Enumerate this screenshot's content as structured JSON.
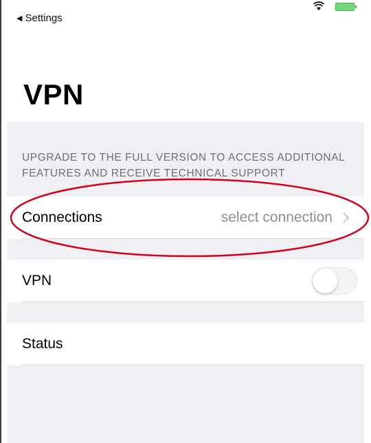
{
  "status_bar": {
    "back_label": "Settings",
    "icons": [
      "wifi-icon",
      "battery-icon"
    ],
    "battery_color": "#39b54a"
  },
  "header": {
    "title": "VPN"
  },
  "upgrade_note": "UPGRADE TO THE FULL VERSION TO ACCESS ADDITIONAL FEATURES AND RECEIVE TECHNICAL SUPPORT",
  "rows": {
    "connections": {
      "label": "Connections",
      "value": "select connection"
    },
    "vpn": {
      "label": "VPN",
      "toggle_on": false
    },
    "status": {
      "label": "Status"
    }
  },
  "annotation": {
    "shape": "ellipse",
    "color": "#d0021b",
    "target": "connections-row"
  }
}
